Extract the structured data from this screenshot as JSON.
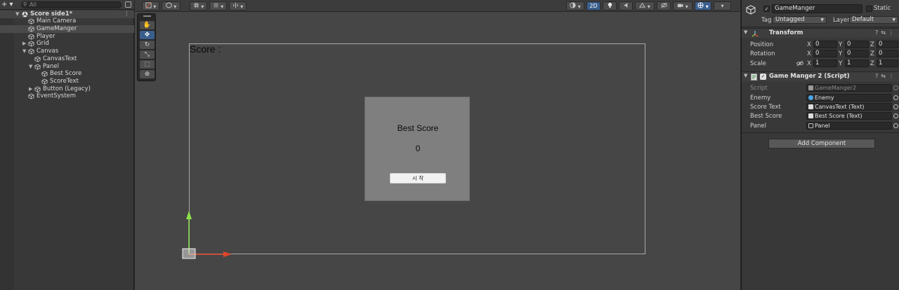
{
  "hierarchy": {
    "add_label": "+ ▾",
    "search_placeholder": "All",
    "scene_name": "Score side1*",
    "items": [
      {
        "label": "Main Camera"
      },
      {
        "label": "GameManger"
      },
      {
        "label": "Player"
      },
      {
        "label": "Grid"
      },
      {
        "label": "Canvas"
      },
      {
        "label": "CanvasText"
      },
      {
        "label": "Panel"
      },
      {
        "label": "Best Score"
      },
      {
        "label": "ScoreText"
      },
      {
        "label": "Button (Legacy)"
      },
      {
        "label": "EventSystem"
      }
    ]
  },
  "scene_toolbar": {
    "mode_2d": "2D"
  },
  "scene": {
    "score_text": "Score :",
    "panel": {
      "title": "Best Score",
      "value": "0",
      "button_label": "시 작"
    }
  },
  "inspector": {
    "object_name": "GameManger",
    "static_label": "Static",
    "tag_label": "Tag",
    "tag_value": "Untagged",
    "layer_label": "Layer",
    "layer_value": "Default",
    "transform": {
      "title": "Transform",
      "rows": [
        {
          "label": "Position",
          "x": "0",
          "y": "0",
          "z": "0"
        },
        {
          "label": "Rotation",
          "x": "0",
          "y": "0",
          "z": "0"
        },
        {
          "label": "Scale",
          "x": "1",
          "y": "1",
          "z": "1"
        }
      ],
      "axis_x": "X",
      "axis_y": "Y",
      "axis_z": "Z"
    },
    "script_component": {
      "title": "Game Manger 2 (Script)",
      "fields": [
        {
          "label": "Script",
          "value": "GameManger2"
        },
        {
          "label": "Enemy",
          "value": "Enemy"
        },
        {
          "label": "Score Text",
          "value": "CanvasText (Text)"
        },
        {
          "label": "Best Score",
          "value": "Best Score (Text)"
        },
        {
          "label": "Panel",
          "value": "Panel"
        }
      ]
    },
    "add_component_label": "Add Component"
  },
  "colors": {
    "selection_blue": "#3a5f8d",
    "y_axis": "#8ee04a",
    "x_axis": "#e0452c"
  }
}
